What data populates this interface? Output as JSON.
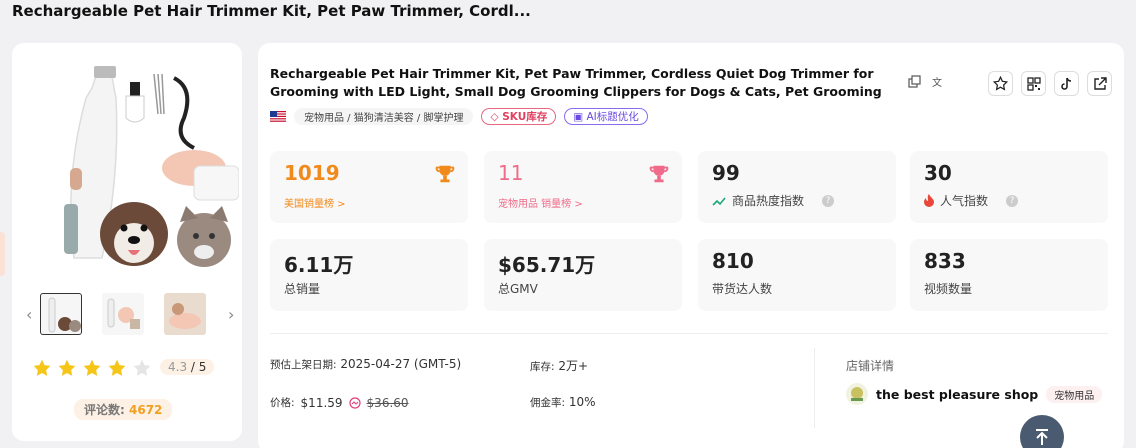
{
  "page": {
    "title": "Rechargeable Pet Hair Trimmer Kit, Pet Paw Trimmer, Cordl..."
  },
  "product": {
    "title": "Rechargeable Pet Hair Trimmer Kit, Pet Paw Trimmer, Cordless Quiet Dog Trimmer for Grooming with LED Light, Small Dog Grooming Clippers for Dogs & Cats, Pet Grooming Tool,Waterproof, lo...",
    "category_path": "宠物用品 / 猫狗清洁美容 / 脚掌护理",
    "sku_label": "SKU库存",
    "ai_label": "AI标题优化",
    "rating": "4.3",
    "rating_max": "/ 5",
    "rating_stars_filled": 4,
    "rating_stars_total": 5,
    "reviews_label": "评论数:",
    "reviews_count": "4672"
  },
  "stats": {
    "us_rank": {
      "value": "1019",
      "label": "美国销量榜 >"
    },
    "cat_rank": {
      "value": "11",
      "label": "宠物用品 销量榜 >"
    },
    "heat": {
      "value": "99",
      "label": "商品热度指数"
    },
    "popularity": {
      "value": "30",
      "label": "人气指数"
    },
    "total_sales": {
      "value": "6.11万",
      "label": "总销量"
    },
    "gmv": {
      "value": "$65.71万",
      "label": "总GMV"
    },
    "influencers": {
      "value": "810",
      "label": "带货达人数"
    },
    "videos": {
      "value": "833",
      "label": "视频数量"
    }
  },
  "details": {
    "launch_label": "预估上架日期:",
    "launch_value": "2025-04-27 (GMT-5)",
    "stock_label": "库存:",
    "stock_value": "2万+",
    "price_label": "价格:",
    "price_value": "$11.59",
    "price_original": "$36.60",
    "commission_label": "佣金率:",
    "commission_value": "10%"
  },
  "shop": {
    "header": "店铺详情",
    "name": "the best pleasure shop",
    "category": "宠物用品"
  },
  "colors": {
    "orange": "#f08a1c",
    "pink": "#f06b8a",
    "star": "#f5c518",
    "fab": "#4a5a70"
  }
}
